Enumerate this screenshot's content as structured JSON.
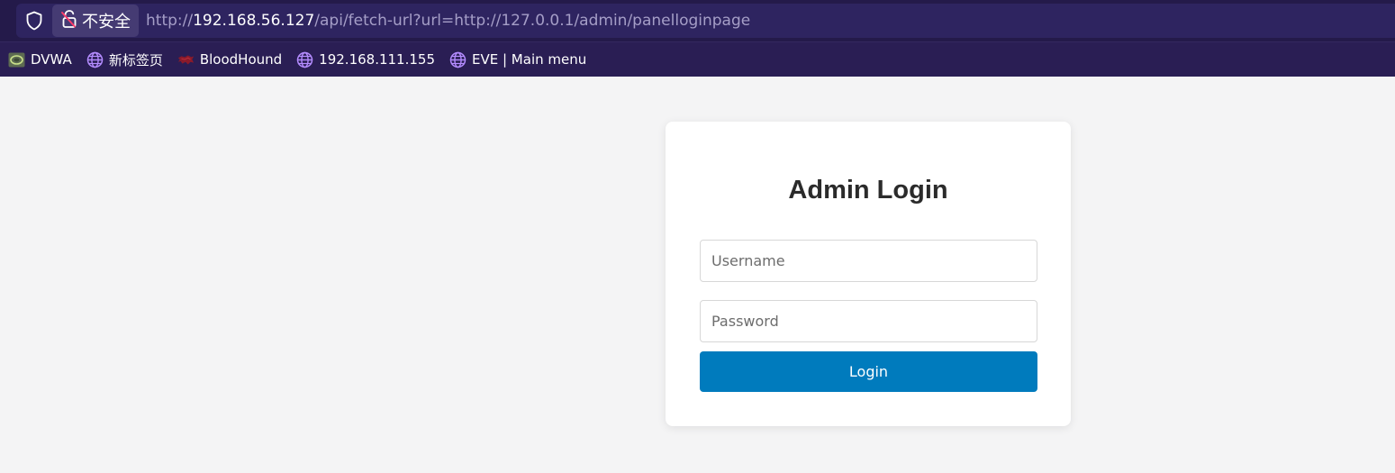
{
  "browser": {
    "security_label": "不安全",
    "url": {
      "scheme": "http://",
      "host": "192.168.56.127",
      "path": "/api/fetch-url?url=http://127.0.0.1/admin/panelloginpage"
    },
    "bookmarks": [
      {
        "label": "DVWA",
        "icon": "dvwa-icon"
      },
      {
        "label": "新标签页",
        "icon": "globe-icon"
      },
      {
        "label": "BloodHound",
        "icon": "bloodhound-icon"
      },
      {
        "label": "192.168.111.155",
        "icon": "globe-icon"
      },
      {
        "label": "EVE | Main menu",
        "icon": "globe-icon"
      }
    ],
    "colors": {
      "chrome_background": "#241a4a",
      "url_bar": "#2e2460",
      "globe_icon": "#b48cff"
    }
  },
  "login": {
    "title": "Admin Login",
    "username_placeholder": "Username",
    "username_value": "",
    "password_placeholder": "Password",
    "password_value": "",
    "button_label": "Login"
  },
  "colors": {
    "page_background": "#f4f4f5",
    "card_background": "#ffffff",
    "button_background": "#007bbd",
    "button_text": "#ffffff"
  }
}
